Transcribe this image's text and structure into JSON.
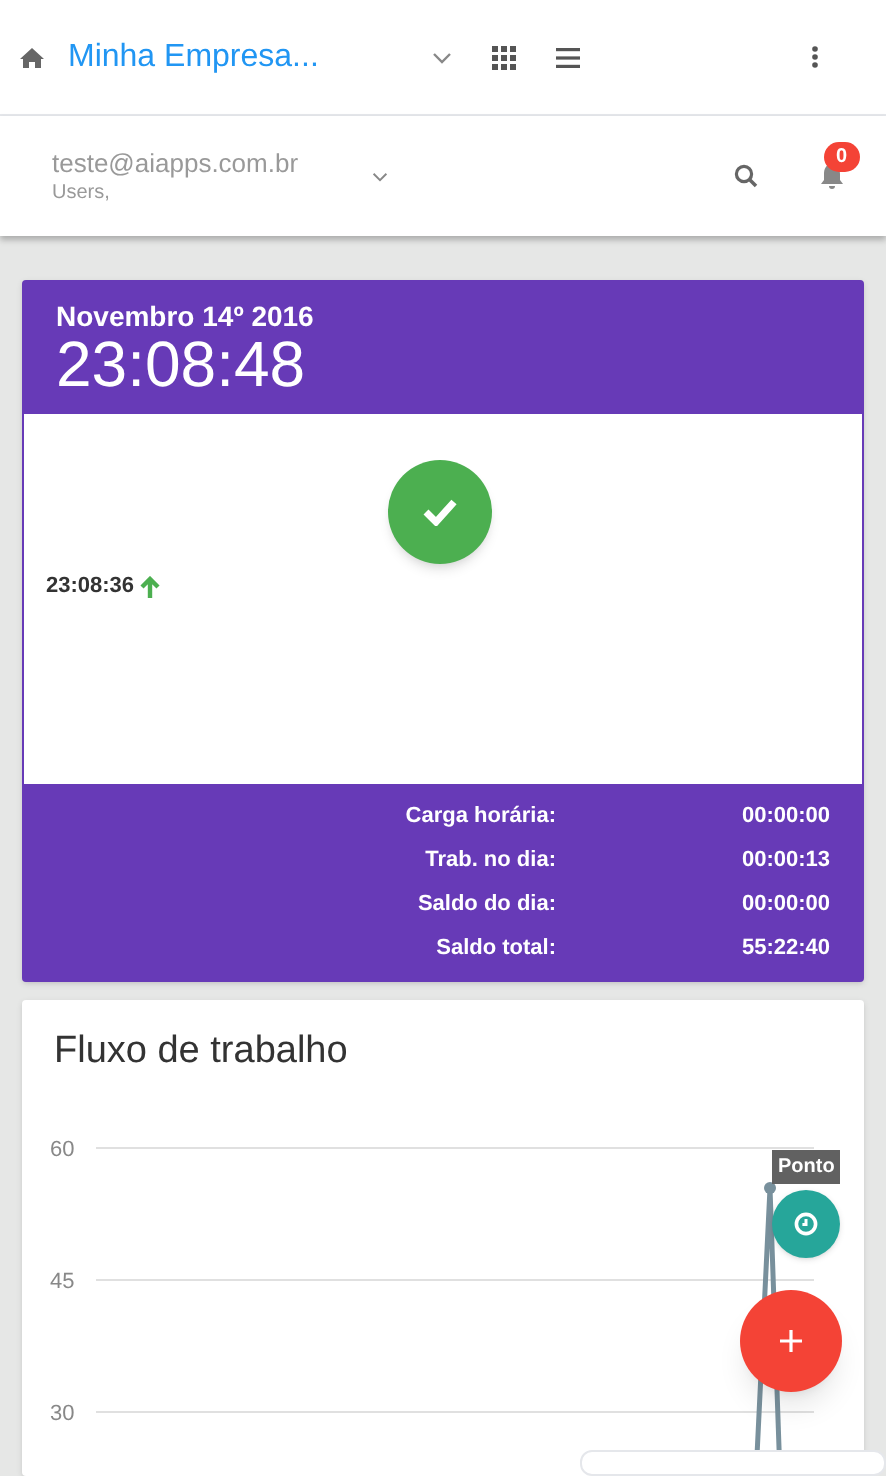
{
  "topbar": {
    "company": "Minha Empresa..."
  },
  "userbar": {
    "email": "teste@aiapps.com.br",
    "role": "Users,",
    "notifications": "0"
  },
  "clock": {
    "date": "Novembro 14º 2016",
    "time": "23:08:48",
    "punch_time": "23:08:36"
  },
  "summary": [
    {
      "label": "Carga horária:",
      "value": "00:00:00"
    },
    {
      "label": "Trab. no dia:",
      "value": "00:00:13"
    },
    {
      "label": "Saldo do dia:",
      "value": "00:00:00"
    },
    {
      "label": "Saldo total:",
      "value": "55:22:40"
    }
  ],
  "workflow": {
    "title": "Fluxo de trabalho",
    "y_axis_labels": [
      "60",
      "45",
      "30"
    ]
  },
  "fab_menu": {
    "label": "Ponto"
  }
}
